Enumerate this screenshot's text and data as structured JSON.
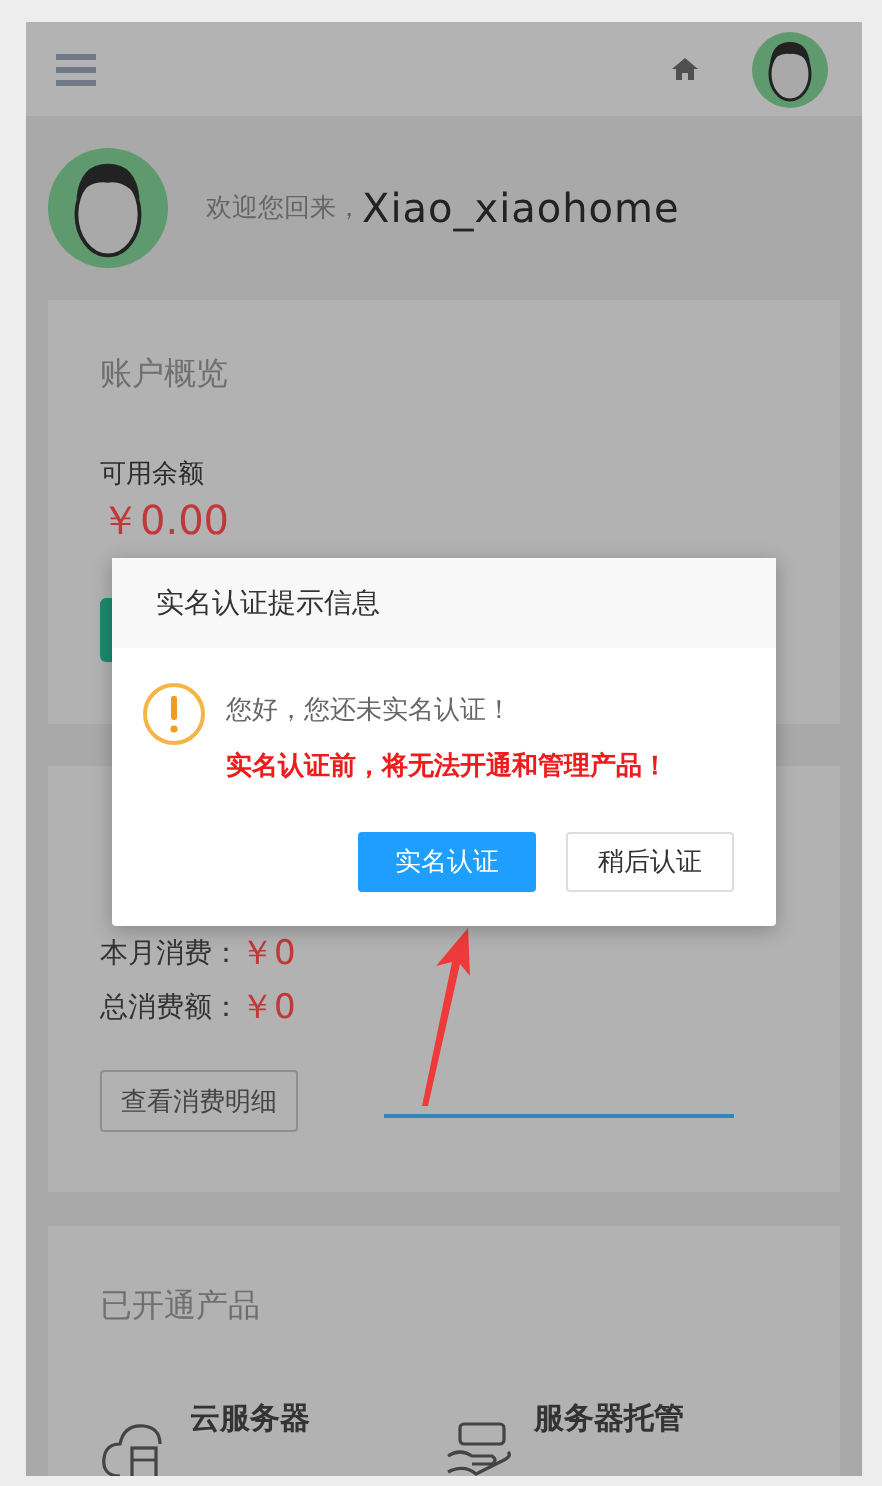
{
  "welcome": {
    "greeting": "欢迎您回来，",
    "username": "Xiao_xiaohome"
  },
  "account_card": {
    "title": "账户概览",
    "balance_label": "可用余额",
    "balance": "￥0.00"
  },
  "spending_card": {
    "rows": [
      {
        "label": "本月消费：",
        "amount": "￥0"
      },
      {
        "label": "总消费额：",
        "amount": "￥0"
      }
    ],
    "button": "查看消费明细"
  },
  "products_card": {
    "title": "已开通产品",
    "products": [
      {
        "name": "云服务器",
        "kind": "cloud"
      },
      {
        "name": "服务器托管",
        "kind": "hosting"
      }
    ]
  },
  "dialog": {
    "title": "实名认证提示信息",
    "message": "您好，您还未实名认证！",
    "warning": "实名认证前，将无法开通和管理产品！",
    "buttons": [
      {
        "label": "实名认证",
        "kind": "primary"
      },
      {
        "label": "稍后认证",
        "kind": "default"
      }
    ]
  }
}
